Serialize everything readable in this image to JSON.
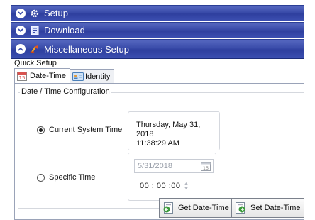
{
  "accordion": [
    {
      "label": "Setup",
      "expanded": false,
      "icon": "gear-icon"
    },
    {
      "label": "Download",
      "expanded": false,
      "icon": "download-icon"
    },
    {
      "label": "Miscellaneous Setup",
      "expanded": true,
      "icon": "misc-setup-icon"
    }
  ],
  "quick_setup": {
    "label": "Quick Setup",
    "tabs": [
      {
        "label": "Date-Time",
        "active": true,
        "icon": "calendar-icon"
      },
      {
        "label": "Identity",
        "active": false,
        "icon": "id-card-icon"
      }
    ]
  },
  "datetime": {
    "group_title": "Date / Time Configuration",
    "current_label": "Current System Time",
    "current_selected": true,
    "current_date": "Thursday, May 31, 2018",
    "current_time": "11:38:29 AM",
    "specific_label": "Specific Time",
    "specific_selected": false,
    "specific_date": "5/31/2018",
    "calendar_day": "15",
    "specific_time": "00 : 00 :00",
    "get_button": "Get Date-Time",
    "set_button": "Set Date-Time"
  },
  "colors": {
    "header_blue": "#3a4caa",
    "header_text": "#ffffff"
  }
}
